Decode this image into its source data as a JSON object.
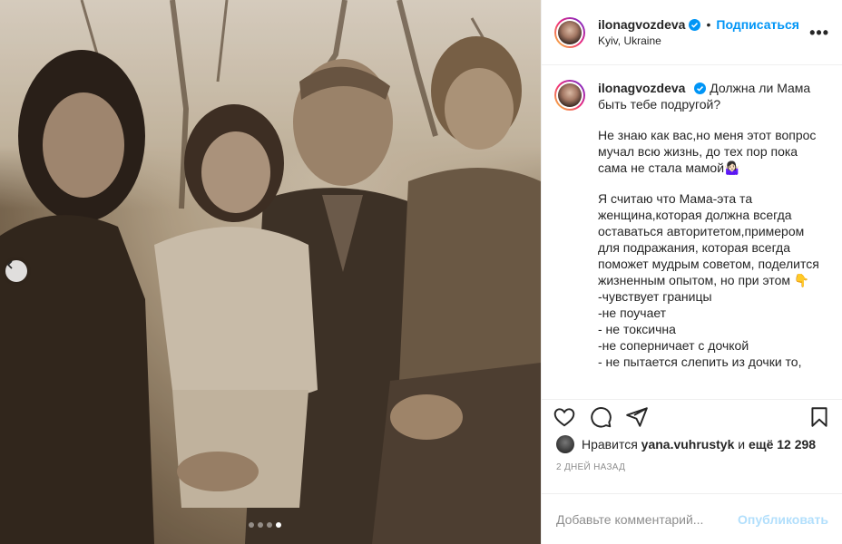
{
  "photo": {
    "description_icon_prev": "chevron-left-icon",
    "carousel": {
      "count": 4,
      "active_index": 3
    }
  },
  "post": {
    "username": "ilonagvozdeva",
    "verified_icon": "verified-badge-icon",
    "separator": "•",
    "follow_label": "Подписаться",
    "location": "Kyiv, Ukraine",
    "more_icon": "more-options-icon",
    "caption_title": "Должна ли Мама быть тебе подругой?",
    "caption_p1": "Не знаю как вас,но меня этот вопрос мучал всю жизнь, до тех пор пока сама не стала мамой🤷🏻‍♀️",
    "caption_p2": "Я считаю что Мама-эта та женщина,которая должна всегда оставаться авторитетом,примером для подражания, которая всегда поможет мудрым советом, поделится жизненным опытом, но при этом 👇\n-чувствует границы\n-не поучает\n- не токсична\n-не соперничает с дочкой\n- не пытается слепить из дочки то,"
  },
  "actions": {
    "like_icon": "heart-icon",
    "comment_icon": "comment-icon",
    "share_icon": "share-icon",
    "save_icon": "bookmark-icon"
  },
  "likes": {
    "prefix": "Нравится",
    "user": "yana.vuhrustyk",
    "connector": "и",
    "others": "ещё 12 298"
  },
  "timestamp": "2 ДНЕЙ НАЗАД",
  "comment": {
    "placeholder": "Добавьте комментарий...",
    "publish_label": "Опубликовать"
  },
  "colors": {
    "accent": "#0095f6",
    "publish_disabled": "#b2dffc",
    "muted": "#8e8e8e"
  }
}
